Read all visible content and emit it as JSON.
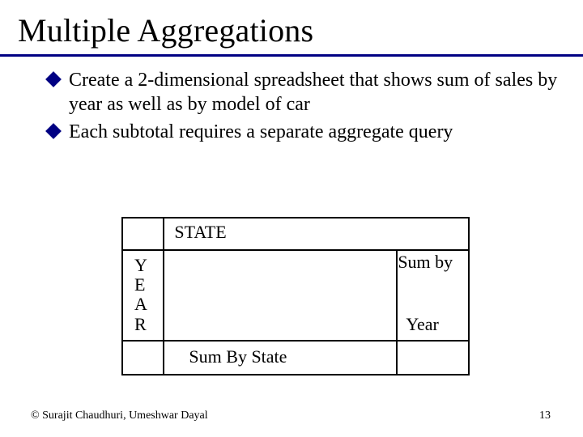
{
  "title": "Multiple Aggregations",
  "bullets": [
    "Create a 2-dimensional spreadsheet that shows sum of sales by year as well as by model of car",
    "Each subtotal requires a separate aggregate query"
  ],
  "table": {
    "col_header": "STATE",
    "row_header_vertical": "Y\nE\nA\nR",
    "right_top": "Sum by",
    "right_bottom": "Year",
    "bottom_label": "Sum By State"
  },
  "footer": {
    "copyright": "© Surajit Chaudhuri, Umeshwar Dayal",
    "page": "13"
  }
}
